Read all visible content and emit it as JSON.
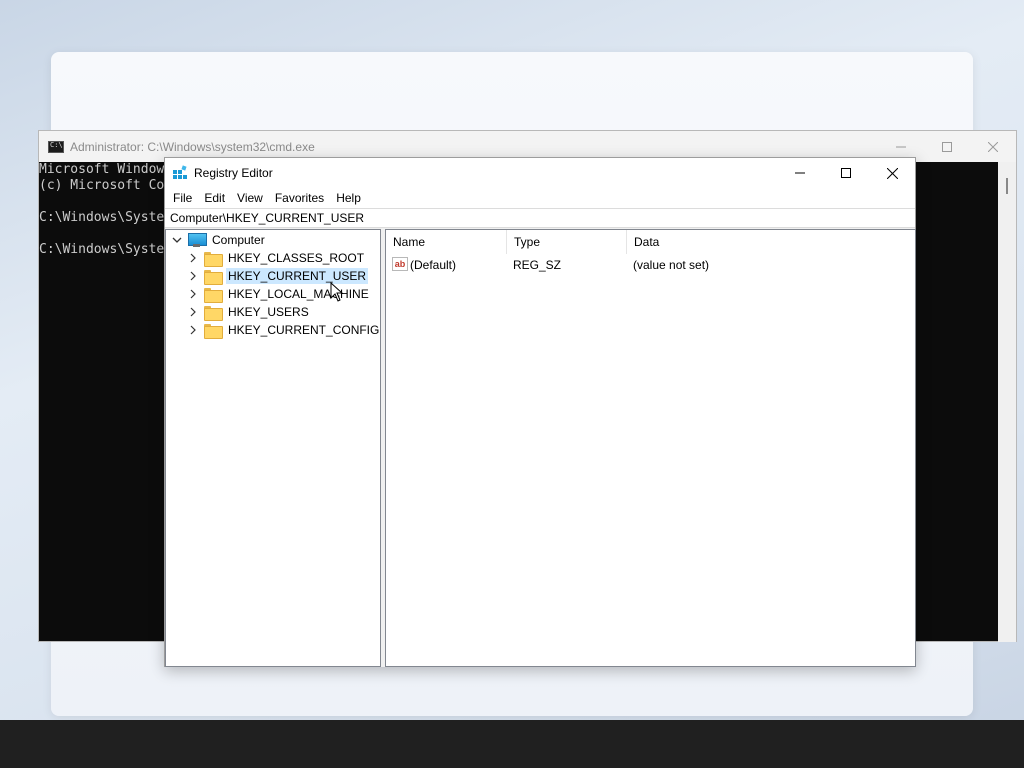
{
  "cmd": {
    "title": "Administrator: C:\\Windows\\system32\\cmd.exe",
    "lines": [
      "Microsoft Windows",
      "(c) Microsoft Co",
      "",
      "C:\\Windows\\Syste",
      "",
      "C:\\Windows\\Syste"
    ]
  },
  "regedit": {
    "title": "Registry Editor",
    "menu": [
      "File",
      "Edit",
      "View",
      "Favorites",
      "Help"
    ],
    "address": "Computer\\HKEY_CURRENT_USER",
    "tree": {
      "root": "Computer",
      "children": [
        "HKEY_CLASSES_ROOT",
        "HKEY_CURRENT_USER",
        "HKEY_LOCAL_MACHINE",
        "HKEY_USERS",
        "HKEY_CURRENT_CONFIG"
      ],
      "selected_index": 1
    },
    "columns": [
      "Name",
      "Type",
      "Data"
    ],
    "values": [
      {
        "name": "(Default)",
        "type": "REG_SZ",
        "data": "(value not set)",
        "icon": "ab"
      }
    ]
  },
  "colors": {
    "selection": "#cce8ff",
    "console_bg": "#0c0c0c",
    "taskbar": "#202020"
  }
}
